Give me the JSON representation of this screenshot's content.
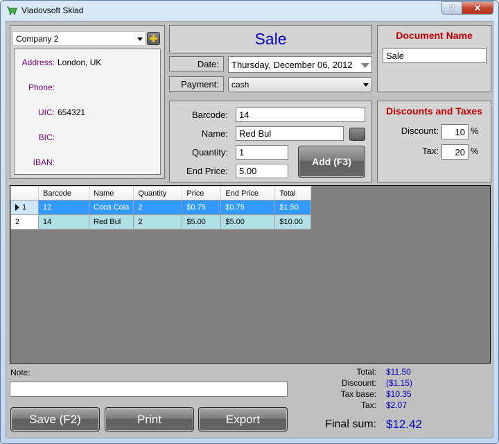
{
  "window": {
    "title": "Vladovsoft Sklad",
    "icon": "shopping-cart-icon",
    "help_label": "?",
    "close_label": "✕"
  },
  "company": {
    "selected": "Company 2",
    "add_icon": "plus-icon",
    "address_label": "Address:",
    "address_value": "London, UK",
    "phone_label": "Phone:",
    "phone_value": "",
    "uic_label": "UIC:",
    "uic_value": "654321",
    "bic_label": "BIC:",
    "bic_value": "",
    "iban_label": "IBAN:",
    "iban_value": ""
  },
  "document": {
    "type_title": "Sale",
    "date_label": "Date:",
    "date_value": "Thursday, December 06, 2012",
    "payment_label": "Payment:",
    "payment_value": "cash"
  },
  "item_entry": {
    "barcode_label": "Barcode:",
    "barcode_value": "14",
    "name_label": "Name:",
    "name_value": "Red Bul",
    "browse_label": "...",
    "quantity_label": "Quantity:",
    "quantity_value": "1",
    "end_price_label": "End Price:",
    "end_price_value": "5.00",
    "add_button": "Add (F3)"
  },
  "document_name": {
    "heading": "Document Name",
    "value": "Sale"
  },
  "discounts_taxes": {
    "heading": "Discounts and Taxes",
    "discount_label": "Discount:",
    "discount_value": "10",
    "tax_label": "Tax:",
    "tax_value": "20",
    "percent": "%"
  },
  "grid": {
    "columns": [
      "Barcode",
      "Name",
      "Quantity",
      "Price",
      "End Price",
      "Total"
    ],
    "rows": [
      {
        "num": "1",
        "barcode": "12",
        "name": "Coca Cola",
        "quantity": "2",
        "price": "$0.75",
        "end_price": "$0.75",
        "total": "$1.50",
        "selected": true
      },
      {
        "num": "2",
        "barcode": "14",
        "name": "Red Bul",
        "quantity": "2",
        "price": "$5.00",
        "end_price": "$5.00",
        "total": "$10.00",
        "selected": false
      }
    ]
  },
  "note": {
    "label": "Note:",
    "value": ""
  },
  "actions": {
    "save": "Save (F2)",
    "print": "Print",
    "export": "Export"
  },
  "summary": {
    "total_label": "Total:",
    "total_value": "$11.50",
    "discount_label": "Discount:",
    "discount_value": "($1.15)",
    "tax_base_label": "Tax base:",
    "tax_base_value": "$10.35",
    "tax_label": "Tax:",
    "tax_value": "$2.07",
    "final_label": "Final sum:",
    "final_value": "$12.42"
  },
  "colors": {
    "title_blue": "#0000c0",
    "heading_red": "#c00000",
    "label_purple": "#800080",
    "selected_row": "#3399ff",
    "alt_row": "#b0dfe5"
  }
}
